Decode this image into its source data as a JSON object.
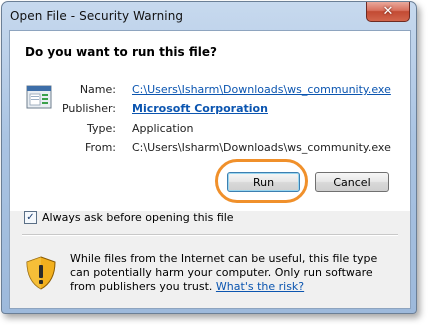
{
  "window": {
    "title": "Open File - Security Warning",
    "close_glyph": "✕"
  },
  "question": "Do you want to run this file?",
  "fields": [
    {
      "label": "Name:",
      "value": "C:\\Users\\Isharm\\Downloads\\ws_community.exe"
    },
    {
      "label": "Publisher:",
      "value": "Microsoft Corporation"
    },
    {
      "label": "Type:",
      "value": "Application"
    },
    {
      "label": "From:",
      "value": "C:\\Users\\Isharm\\Downloads\\ws_community.exe"
    }
  ],
  "buttons": {
    "run": "Run",
    "cancel": "Cancel"
  },
  "checkbox": {
    "label": "Always ask before opening this file",
    "checked": true,
    "mark": "✓"
  },
  "warning": {
    "text": "While files from the Internet can be useful, this file type can potentially harm your computer. Only run software from publishers you trust.",
    "link": "What's the risk?"
  },
  "colors": {
    "link": "#0b55b0",
    "highlight": "#f0902b",
    "shield": "#f2b01e"
  }
}
